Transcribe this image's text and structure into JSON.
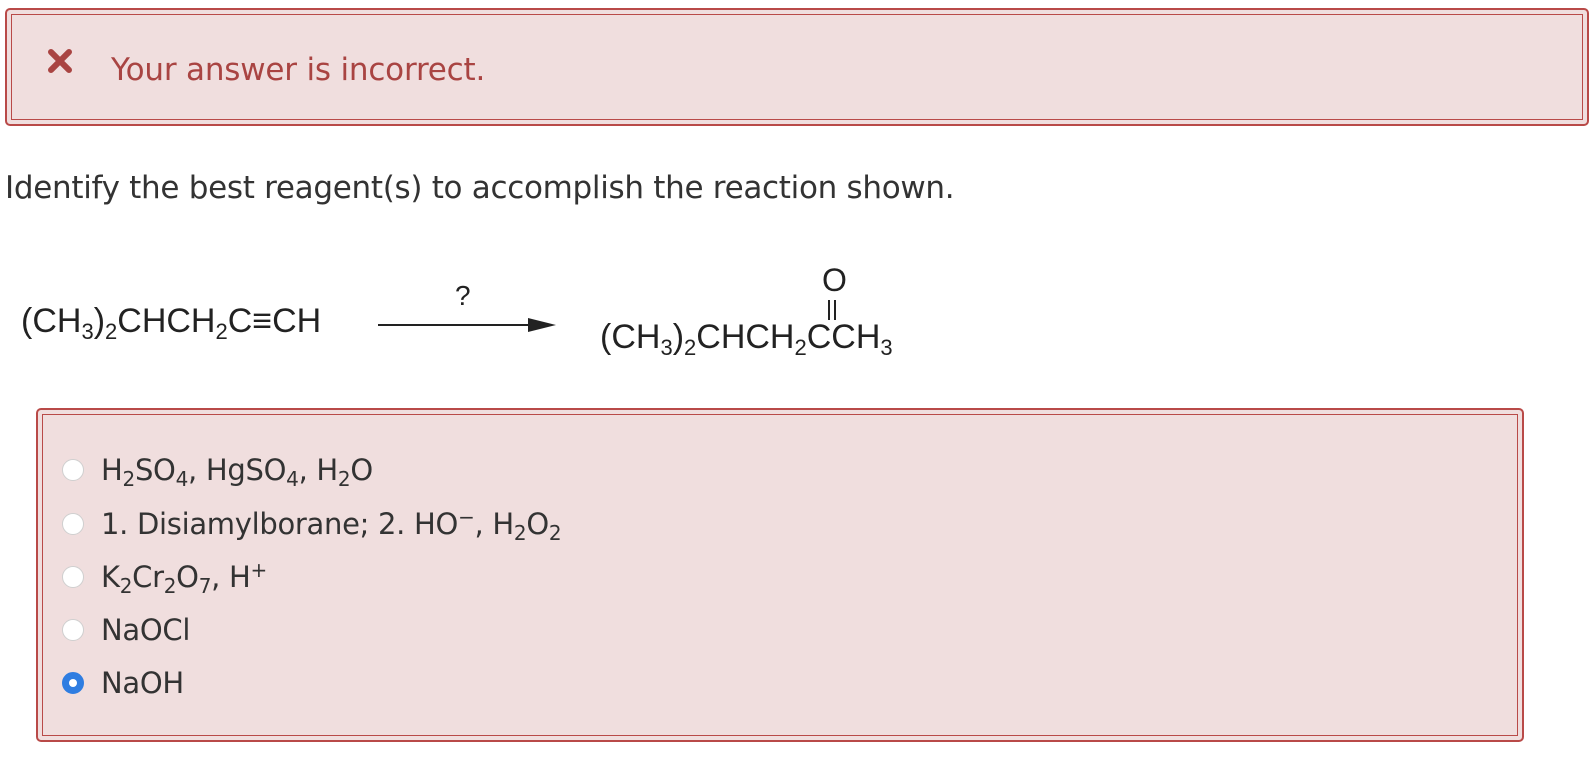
{
  "feedback": {
    "message": "Your answer is incorrect.",
    "icon": "close-icon",
    "color": "#a94442",
    "background": "#f0dede"
  },
  "question": {
    "prompt": "Identify the best reagent(s) to accomplish the reaction shown."
  },
  "reaction": {
    "reactant": {
      "part1": "(CH",
      "sub1": "3",
      "part2": ")",
      "sub2": "2",
      "part3": "CHCH",
      "sub3": "2",
      "part4": "C≡CH"
    },
    "arrow_label": "?",
    "product": {
      "part1": "(CH",
      "sub1": "3",
      "part2": ")",
      "sub2": "2",
      "part3": "CHCH",
      "sub3": "2",
      "part4": "CCH",
      "sub4": "3",
      "carbonyl_oxygen": "O"
    }
  },
  "choices": {
    "selected_index": 4,
    "accent": "#2f7de1",
    "items": [
      {
        "segments": [
          {
            "t": "H"
          },
          {
            "sub": "2"
          },
          {
            "t": "SO"
          },
          {
            "sub": "4"
          },
          {
            "t": ", HgSO"
          },
          {
            "sub": "4"
          },
          {
            "t": ", H"
          },
          {
            "sub": "2"
          },
          {
            "t": "O"
          }
        ]
      },
      {
        "segments": [
          {
            "t": "1. Disiamylborane; 2. HO"
          },
          {
            "sup": "−"
          },
          {
            "t": ", H"
          },
          {
            "sub": "2"
          },
          {
            "t": "O"
          },
          {
            "sub": "2"
          }
        ]
      },
      {
        "segments": [
          {
            "t": "K"
          },
          {
            "sub": "2"
          },
          {
            "t": "Cr"
          },
          {
            "sub": "2"
          },
          {
            "t": "O"
          },
          {
            "sub": "7"
          },
          {
            "t": ", H"
          },
          {
            "sup": "+"
          }
        ]
      },
      {
        "segments": [
          {
            "t": "NaOCl"
          }
        ]
      },
      {
        "segments": [
          {
            "t": "NaOH"
          }
        ]
      }
    ]
  }
}
